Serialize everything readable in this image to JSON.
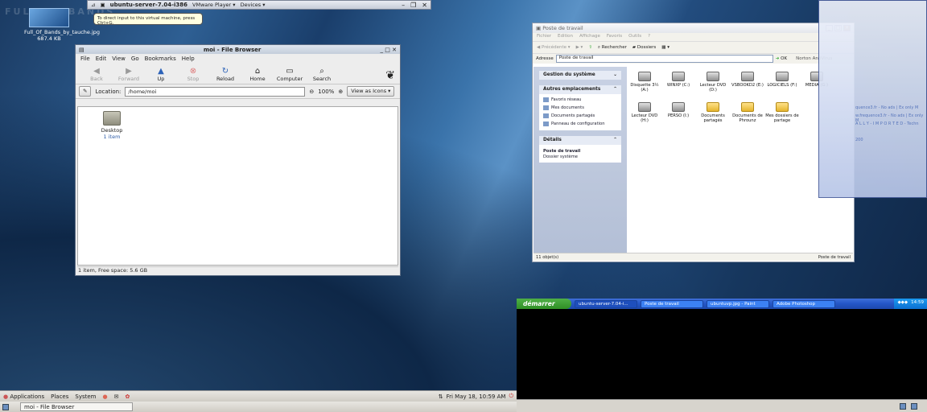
{
  "desktop": {
    "faded_text": "FULL OF BANDS",
    "icon": {
      "name": "Full_Of_Bands_by_tauche.jpg",
      "size": "687.4 KB"
    }
  },
  "vmware": {
    "title": "ubuntu-server-7.04-i386",
    "menus": [
      "VMware Player",
      "Devices"
    ],
    "tooltip": "To direct input to this virtual machine, press Ctrl+G."
  },
  "nautilus": {
    "title": "moi - File Browser",
    "menu": [
      "File",
      "Edit",
      "View",
      "Go",
      "Bookmarks",
      "Help"
    ],
    "toolbar": [
      {
        "label": "Back",
        "icon": "arrow-left-icon",
        "enabled": false
      },
      {
        "label": "Forward",
        "icon": "arrow-right-icon",
        "enabled": false
      },
      {
        "label": "Up",
        "icon": "arrow-up-icon",
        "enabled": true
      },
      {
        "label": "Stop",
        "icon": "stop-icon",
        "enabled": false
      },
      {
        "label": "Reload",
        "icon": "reload-icon",
        "enabled": true
      },
      {
        "label": "Home",
        "icon": "home-icon",
        "enabled": true
      },
      {
        "label": "Computer",
        "icon": "computer-icon",
        "enabled": true
      },
      {
        "label": "Search",
        "icon": "search-icon",
        "enabled": true
      }
    ],
    "location_label": "Location:",
    "location_value": "/home/moi",
    "zoom": "100%",
    "view_mode": "View as Icons",
    "items": [
      {
        "name": "Desktop",
        "info": "1 item"
      }
    ],
    "status": "1 item, Free space: 5.6 GB"
  },
  "explorer": {
    "title": "Poste de travail",
    "menu": [
      "Fichier",
      "Edition",
      "Affichage",
      "Favoris",
      "Outils",
      "?"
    ],
    "toolbar": {
      "back": "Précédente",
      "search": "Rechercher",
      "folders": "Dossiers"
    },
    "address_label": "Adresse",
    "address_value": "Poste de travail",
    "go": "OK",
    "antivirus": "Norton AntiVirus",
    "panels": {
      "system": {
        "title": "Gestion du système"
      },
      "places": {
        "title": "Autres emplacements",
        "items": [
          "Favoris réseau",
          "Mes documents",
          "Documents partagés",
          "Panneau de configuration"
        ]
      },
      "details": {
        "title": "Détails",
        "name": "Poste de travail",
        "type": "Dossier système"
      }
    },
    "drives": [
      {
        "label": "Disquette 3½ (A:)",
        "kind": "drive"
      },
      {
        "label": "WINXP (C:)",
        "kind": "drive"
      },
      {
        "label": "Lecteur DVD (D:)",
        "kind": "drive"
      },
      {
        "label": "VSBOOKD2 (E:)",
        "kind": "drive"
      },
      {
        "label": "LOGICIELS (F:)",
        "kind": "drive"
      },
      {
        "label": "MEDIA (G:)",
        "kind": "drive"
      },
      {
        "label": "Lecteur DVD (H:)",
        "kind": "drive"
      },
      {
        "label": "PERSO (I:)",
        "kind": "drive"
      },
      {
        "label": "Documents partagés",
        "kind": "folder"
      },
      {
        "label": "Documents de Phrounz",
        "kind": "folder"
      },
      {
        "label": "Mes dossiers de partage",
        "kind": "folder"
      }
    ],
    "status_left": "11 objet(s)",
    "status_right": "Poste de travail"
  },
  "xp_taskbar": {
    "start": "démarrer",
    "tasks": [
      "ubuntu-server-7.04-i...",
      "Poste de travail",
      "ubuntuvp.jpg - Paint",
      "Adobe Photoshop"
    ],
    "clock": "14:59"
  },
  "gnome": {
    "menus": [
      "Applications",
      "Places",
      "System"
    ],
    "clock": "Fri May 18, 10:59 AM",
    "task": "moi - File Browser"
  },
  "right_panel": {
    "lines": [
      "quence3.fr - No ads | Ex only M",
      "w.frequence3.fr - No ads | Ex only M",
      "A L L Y - I M P O R T E D - Techn",
      "200"
    ]
  }
}
